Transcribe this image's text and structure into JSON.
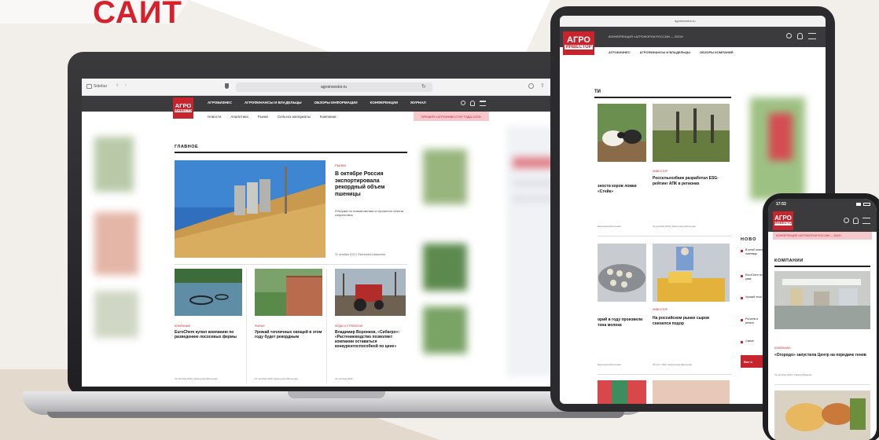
{
  "page": {
    "heading": "САЙТ"
  },
  "colors": {
    "accent": "#c8242e",
    "dark_nav": "#3b3b3e",
    "bg": "#f2eeea"
  },
  "laptop": {
    "browser": {
      "sidebar_label": "Sidebar",
      "url": "agroinvestor.ru"
    },
    "site": {
      "logo_line1": "АГРО",
      "logo_line2": "ИНВЕСТОР",
      "nav": [
        "АГРОБИЗНЕС",
        "АГРОФИНАНСЫ И ВЛАДЕЛЬЦЫ",
        "ОБЗОРЫ ИНФОРМАЦИИ",
        "КОНФЕРЕНЦИИ",
        "ЖУРНАЛ"
      ],
      "subnav": [
        "Новости",
        "Аналитика",
        "Рынки",
        "Сельхоз материалы",
        "Компании"
      ],
      "promo": "ПРЕМИЯ «АГРОИНВЕСТОР ГОДА 2023»",
      "section_title": "ГЛАВНОЕ",
      "main": {
        "tag": "РЫНКИ",
        "title": "В октябре Россия экспортировала рекордный объем пшеницы",
        "lead": "Отгрузки по новым квотам от прошлого сезона сократились",
        "meta": "31 октября 2022 | Екатерина Шипунова"
      },
      "cards": [
        {
          "tag": "КОМПАНИИ",
          "title": "EuroChem купил компанию по разведению лососевых фермы",
          "meta": "31 октября 2022 | Екатерина Шипунова"
        },
        {
          "tag": "РЫНКИ",
          "title": "Урожай тепличных овощей в этом году будет рекордным",
          "meta": "31 октября 2022 | Екатерина Шипунова"
        },
        {
          "tag": "ЛЮДИ И СТРАТЕГИИ",
          "title": "Владимир Воронков, «Сибагро»: «Растениеводство позволяет компании оставаться конкурентоспособной по цене»",
          "meta": "31 октября 2022"
        }
      ]
    }
  },
  "tablet": {
    "url": "agroinvestor.ru",
    "logo_line1": "АГРО",
    "logo_line2": "ИНВЕСТОР",
    "topbar": "КОНФЕРЕНЦИЯ «АГРОФОРУМ РОССИИ — 2023»",
    "nav": [
      "АГРОБИЗНЕС",
      "АГРОФИНАНСЫ И ВЛАДЕЛЬЦЫ",
      "ОБЗОРЫ КОМПАНИЙ"
    ],
    "section_title": "ТИ",
    "cards": [
      {
        "tag": "",
        "title": "зности коров ломки «Стейк»",
        "meta": "Екатерина Шипунова"
      },
      {
        "tag": "ИНВЕСТОР",
        "title": "Россельхозбанк разработал ESG-рейтинг АПК в регионах",
        "meta": "31 октября 2022 | Екатерина Шипунова"
      },
      {
        "tag": "",
        "title": "орий в году произвели тона молока",
        "meta": "Екатерина Шипунова"
      },
      {
        "tag": "ИНВЕСТОР",
        "title": "На российском рынке сыров снизился подор",
        "meta": "28 сент 2022 | Екатерина Шипунова"
      }
    ],
    "news_title": "НОВО",
    "news": [
      "В октяб экспорт пшеницы",
      "EuroChem по разв",
      "Урожай этом год",
      "Россель в регион",
      "Самое"
    ],
    "button": "Все н"
  },
  "phone": {
    "time": "17:53",
    "logo_line1": "АГРО",
    "logo_line2": "ИНВЕСТОР",
    "topbar": "КОНФЕРЕНЦИЯ «АГРОФОРУМ РОССИИ — 2023»",
    "section_title": "КОМПАНИИ",
    "tag": "КОМПАНИИ",
    "title": "«Огородо» запустила Центр на передаче генов",
    "meta": "31 октября 2022 | Максим Фадеев"
  }
}
